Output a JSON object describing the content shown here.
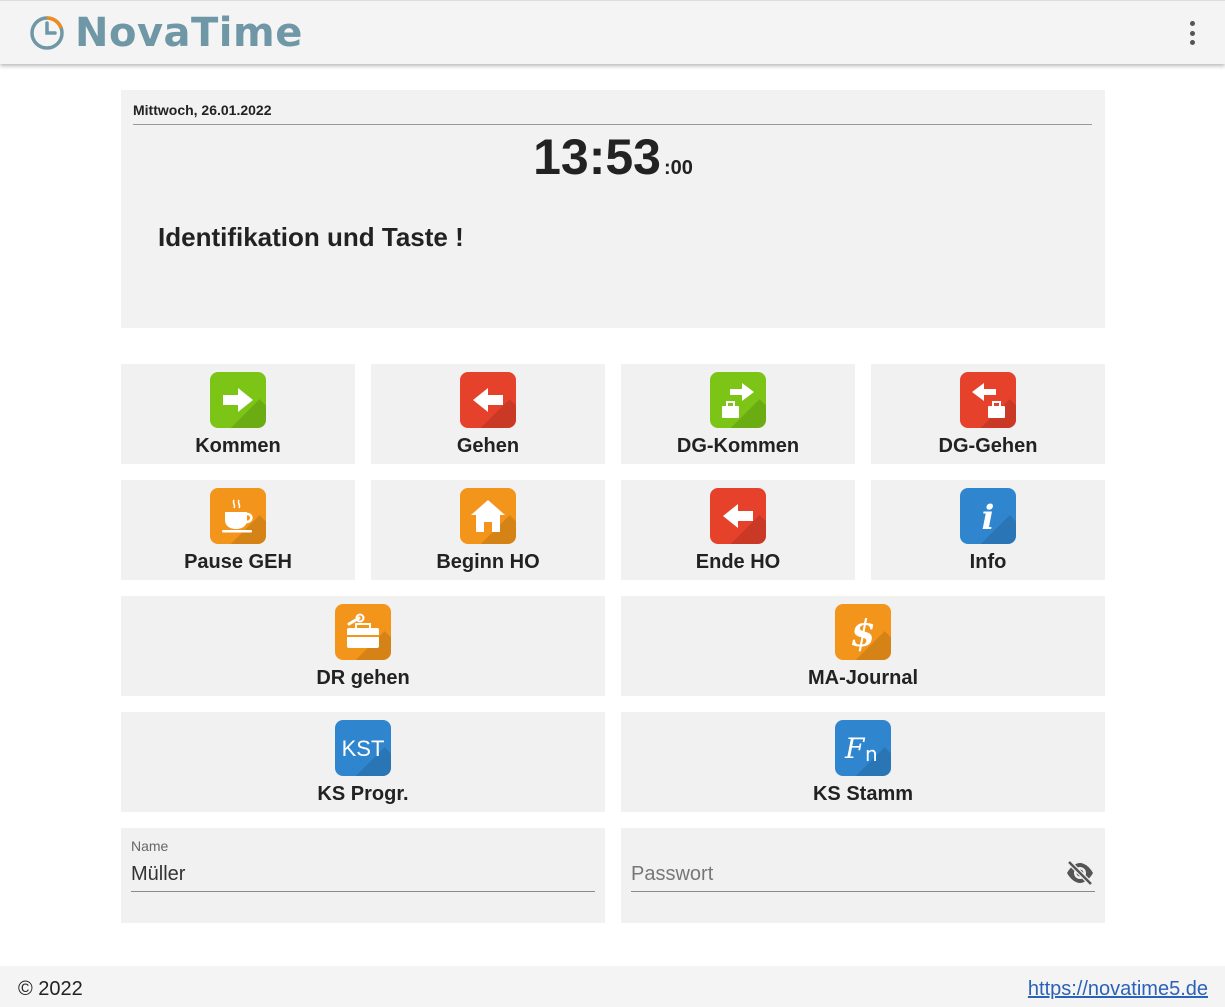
{
  "app": {
    "title": "NovaTime"
  },
  "clock": {
    "date": "Mittwoch, 26.01.2022",
    "time": "13:53",
    "seconds": ":00",
    "prompt": "Identifikation und Taste !"
  },
  "buttons": [
    {
      "label": "Kommen",
      "icon": "arrow-right-icon",
      "color": "#7cc416"
    },
    {
      "label": "Gehen",
      "icon": "arrow-left-icon",
      "color": "#e5412b"
    },
    {
      "label": "DG-Kommen",
      "icon": "briefcase-arrow-right-icon",
      "color": "#7cc416"
    },
    {
      "label": "DG-Gehen",
      "icon": "briefcase-arrow-left-icon",
      "color": "#e5412b"
    },
    {
      "label": "Pause GEH",
      "icon": "coffee-cup-icon",
      "color": "#f3951a"
    },
    {
      "label": "Beginn HO",
      "icon": "home-icon",
      "color": "#f3951a"
    },
    {
      "label": "Ende HO",
      "icon": "arrow-left-icon",
      "color": "#e5412b"
    },
    {
      "label": "Info",
      "icon": "info-icon",
      "color": "#2f86cf"
    },
    {
      "label": "DR gehen",
      "icon": "toolbox-icon",
      "color": "#f3951a"
    },
    {
      "label": "MA-Journal",
      "icon": "dollar-icon",
      "color": "#f3951a"
    },
    {
      "label": "KS Progr.",
      "icon": "kst-icon",
      "icon_text": "KST",
      "color": "#2f86cf"
    },
    {
      "label": "KS Stamm",
      "icon": "function-icon",
      "icon_text": "F",
      "icon_sub": "n",
      "color": "#2f86cf"
    }
  ],
  "login": {
    "name_label": "Name",
    "name_value": "Müller",
    "password_placeholder": "Passwort"
  },
  "footer": {
    "copyright": "© 2022",
    "link": "https://novatime5.de"
  }
}
